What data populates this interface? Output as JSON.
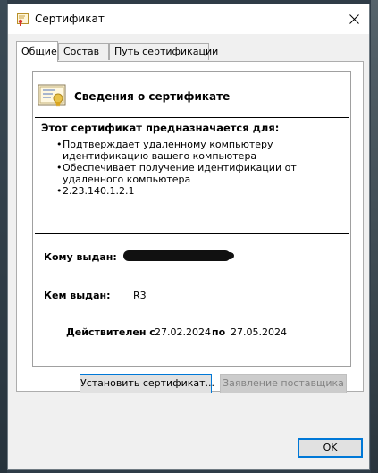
{
  "window": {
    "title": "Сертификат",
    "close_icon": "close-icon"
  },
  "tabs": [
    {
      "label": "Общие",
      "active": true
    },
    {
      "label": "Состав",
      "active": false
    },
    {
      "label": "Путь сертификации",
      "active": false
    }
  ],
  "info": {
    "icon": "certificate-icon",
    "title": "Сведения о сертификате",
    "purpose_heading": "Этот сертификат предназначается для:",
    "purposes": [
      "Подтверждает удаленному компьютеру идентификацию вашего компьютера",
      "Обеспечивает получение идентификации от удаленного компьютера",
      "2.23.140.1.2.1"
    ],
    "issued_to_label": "Кому выдан:",
    "issued_by_label": "Кем выдан:",
    "issued_by_value": "R3",
    "valid_from_label": "Действителен с",
    "valid_from_value": "27.02.2024",
    "valid_to_label": "по",
    "valid_to_value": "27.05.2024"
  },
  "buttons": {
    "install": "Установить сертификат...",
    "issuer_statement": "Заявление поставщика",
    "ok": "OK"
  },
  "colors": {
    "accent": "#0078d7",
    "window_bg": "#f0f0f0",
    "disabled_text": "#838383"
  }
}
